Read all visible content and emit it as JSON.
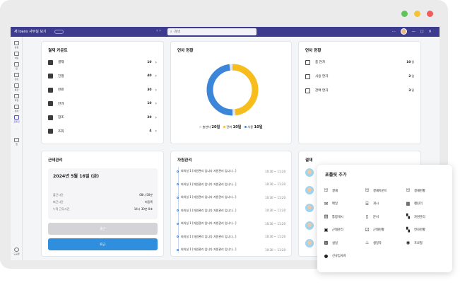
{
  "window": {
    "title": "새 loans 사무실 보기",
    "nav": "‹  ›",
    "search_placeholder": "검색",
    "more": "···"
  },
  "sidebar": {
    "items": [
      {
        "label": "활동"
      },
      {
        "label": "채팅"
      },
      {
        "label": "팀"
      },
      {
        "label": "일정"
      },
      {
        "label": "통화"
      },
      {
        "label": "파일"
      },
      {
        "label": "결재"
      },
      {
        "label": "포틀릿"
      },
      {
        "label": "···"
      },
      {
        "label": "앱"
      },
      {
        "label": "도움말"
      }
    ]
  },
  "approval_count": {
    "title": "결재 카운트",
    "items": [
      {
        "label": "결재",
        "count": "10"
      },
      {
        "label": "진행",
        "count": "40"
      },
      {
        "label": "완료",
        "count": "30"
      },
      {
        "label": "반려",
        "count": "10"
      },
      {
        "label": "참조",
        "count": "20"
      },
      {
        "label": "조회",
        "count": "4"
      }
    ]
  },
  "leave_status": {
    "title": "연차 현황",
    "legend": [
      {
        "label": "총연차",
        "value": "20일",
        "color": "#e4e4ea"
      },
      {
        "label": "잔여",
        "value": "10일",
        "color": "#f6bd1c"
      },
      {
        "label": "사용",
        "value": "10일",
        "color": "#3b86d8"
      }
    ],
    "donut": {
      "remaining_fraction": 0.5,
      "used_fraction": 0.5
    }
  },
  "leave_detail": {
    "title": "연차 현황",
    "items": [
      {
        "label": "총 연차",
        "value": "10",
        "unit": "일"
      },
      {
        "label": "사용 연차",
        "value": "2",
        "unit": "일"
      },
      {
        "label": "잔여 연차",
        "value": "3",
        "unit": "일"
      }
    ]
  },
  "attendance": {
    "title": "근태관리",
    "date": "2024년 5월 16일 (금)",
    "rows": [
      {
        "label": "출근시간",
        "value": "08시 50분"
      },
      {
        "label": "퇴근시간",
        "value": "미등록"
      },
      {
        "label": "누적 근무시간",
        "value": "14시 30분 0초"
      }
    ],
    "checkin_label": "출근",
    "checkout_label": "퇴근"
  },
  "resources": {
    "title": "자원관리",
    "items": [
      {
        "text": "회의실 1 [자원관리 입니다 자원관리 입니다...]",
        "time": "10:30 ~ 11:20"
      },
      {
        "text": "회의실 1 [자원관리 입니다 자원관리 입니다...]",
        "time": "10:30 ~ 11:20"
      },
      {
        "text": "회의실 1 [자원관리 입니다 자원관리 입니다...]",
        "time": "10:30 ~ 11:20"
      },
      {
        "text": "회의실 1 [자원관리 입니다 자원관리 입니다...]",
        "time": "10:30 ~ 11:20"
      },
      {
        "text": "회의실 1 [자원관리 입니다 자원관리 입니다...]",
        "time": "10:30 ~ 11:20"
      },
      {
        "text": "회의실 1 [자원관리 입니다 자원관리 입니다...]",
        "time": "10:30 ~ 11:20"
      },
      {
        "text": "회의실 1 [자원관리 입니다 자원관리 입니다...]",
        "time": "10:30 ~ 11:20"
      }
    ]
  },
  "payment": {
    "title": "결재"
  },
  "portlet_popup": {
    "title": "포틀릿 추가",
    "items": [
      {
        "label": "결재",
        "icon": "stamp-icon"
      },
      {
        "label": "결재카운트",
        "icon": "stamp-icon"
      },
      {
        "label": "결재현황",
        "icon": "stamp-icon"
      },
      {
        "label": "메일",
        "icon": "mail-icon"
      },
      {
        "label": "게시",
        "icon": "archive-icon"
      },
      {
        "label": "캘린더",
        "icon": "calendar-icon"
      },
      {
        "label": "통합게시",
        "icon": "board-icon"
      },
      {
        "label": "문서",
        "icon": "document-icon"
      },
      {
        "label": "자원관리",
        "icon": "grid-icon"
      },
      {
        "label": "근태관리",
        "icon": "attendance-icon"
      },
      {
        "label": "근태현황",
        "icon": "calendar-check-icon"
      },
      {
        "label": "연차현황",
        "icon": "grid-icon"
      },
      {
        "label": "설일",
        "icon": "qr-icon"
      },
      {
        "label": "생일자",
        "icon": "cake-icon"
      },
      {
        "label": "프로필",
        "icon": "profile-icon"
      },
      {
        "label": "신규입사자",
        "icon": "new-employee-icon"
      }
    ]
  },
  "colors": {
    "accent": "#3d3b8e",
    "blue": "#3b86d8",
    "yellow": "#f6bd1c"
  }
}
